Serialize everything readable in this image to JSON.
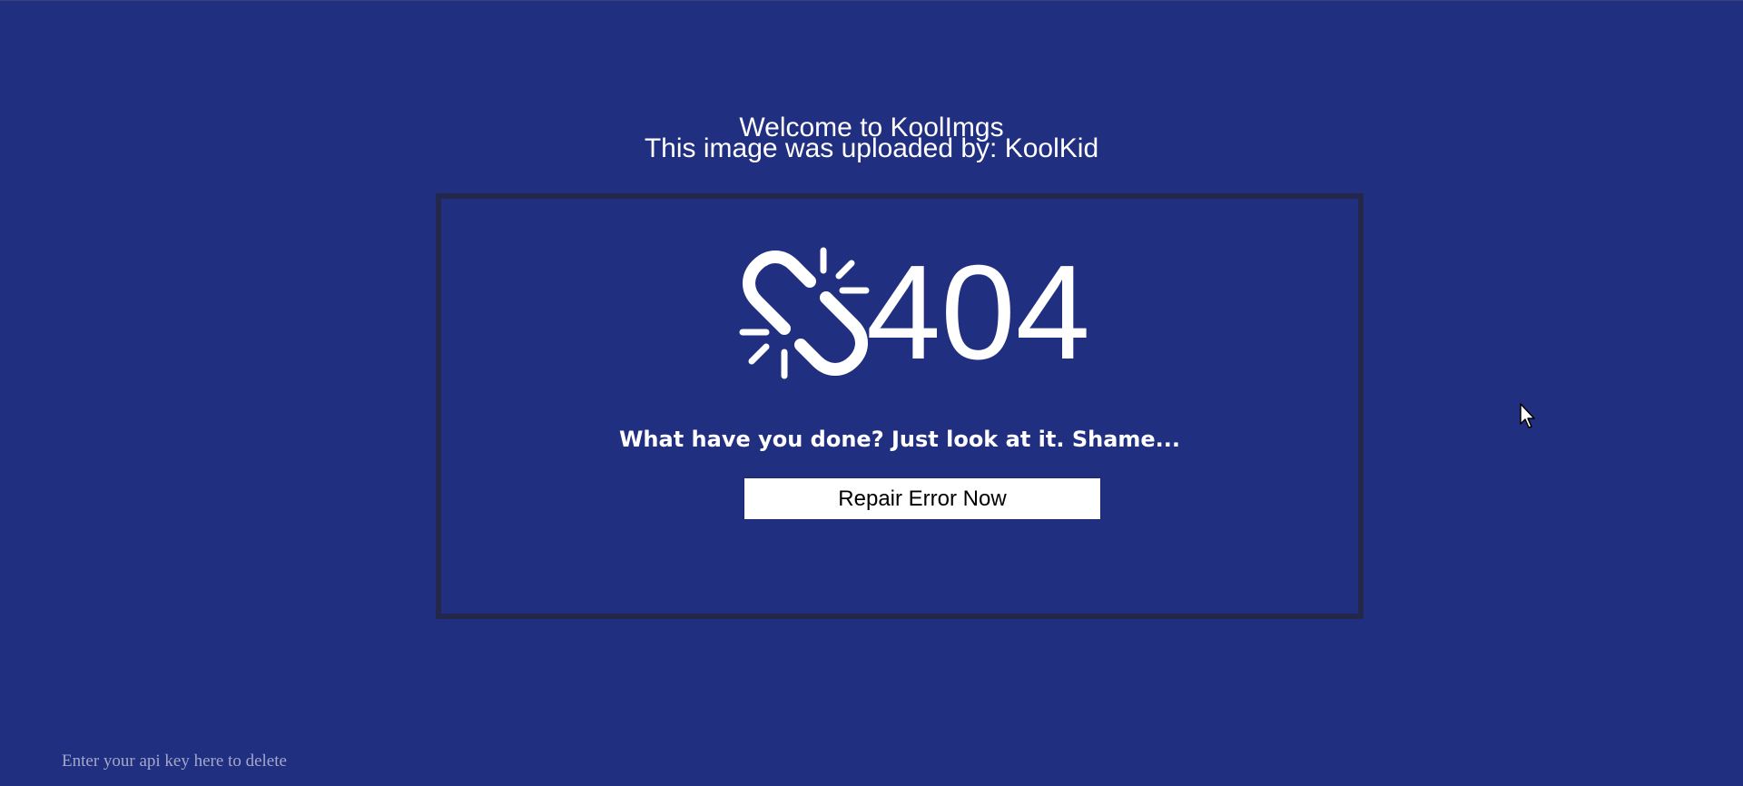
{
  "header": {
    "welcome": "Welcome to KoolImgs",
    "uploader": "This image was uploaded by: KoolKid"
  },
  "error": {
    "code": "404",
    "icon": "broken-link-icon",
    "message": "What have you done? Just look at it. Shame...",
    "button_label": "Repair Error Now"
  },
  "api_key": {
    "placeholder": "Enter your api key here to delete",
    "value": ""
  },
  "colors": {
    "background": "#212f80",
    "card_border": "#23274a",
    "text": "#ffffff"
  }
}
